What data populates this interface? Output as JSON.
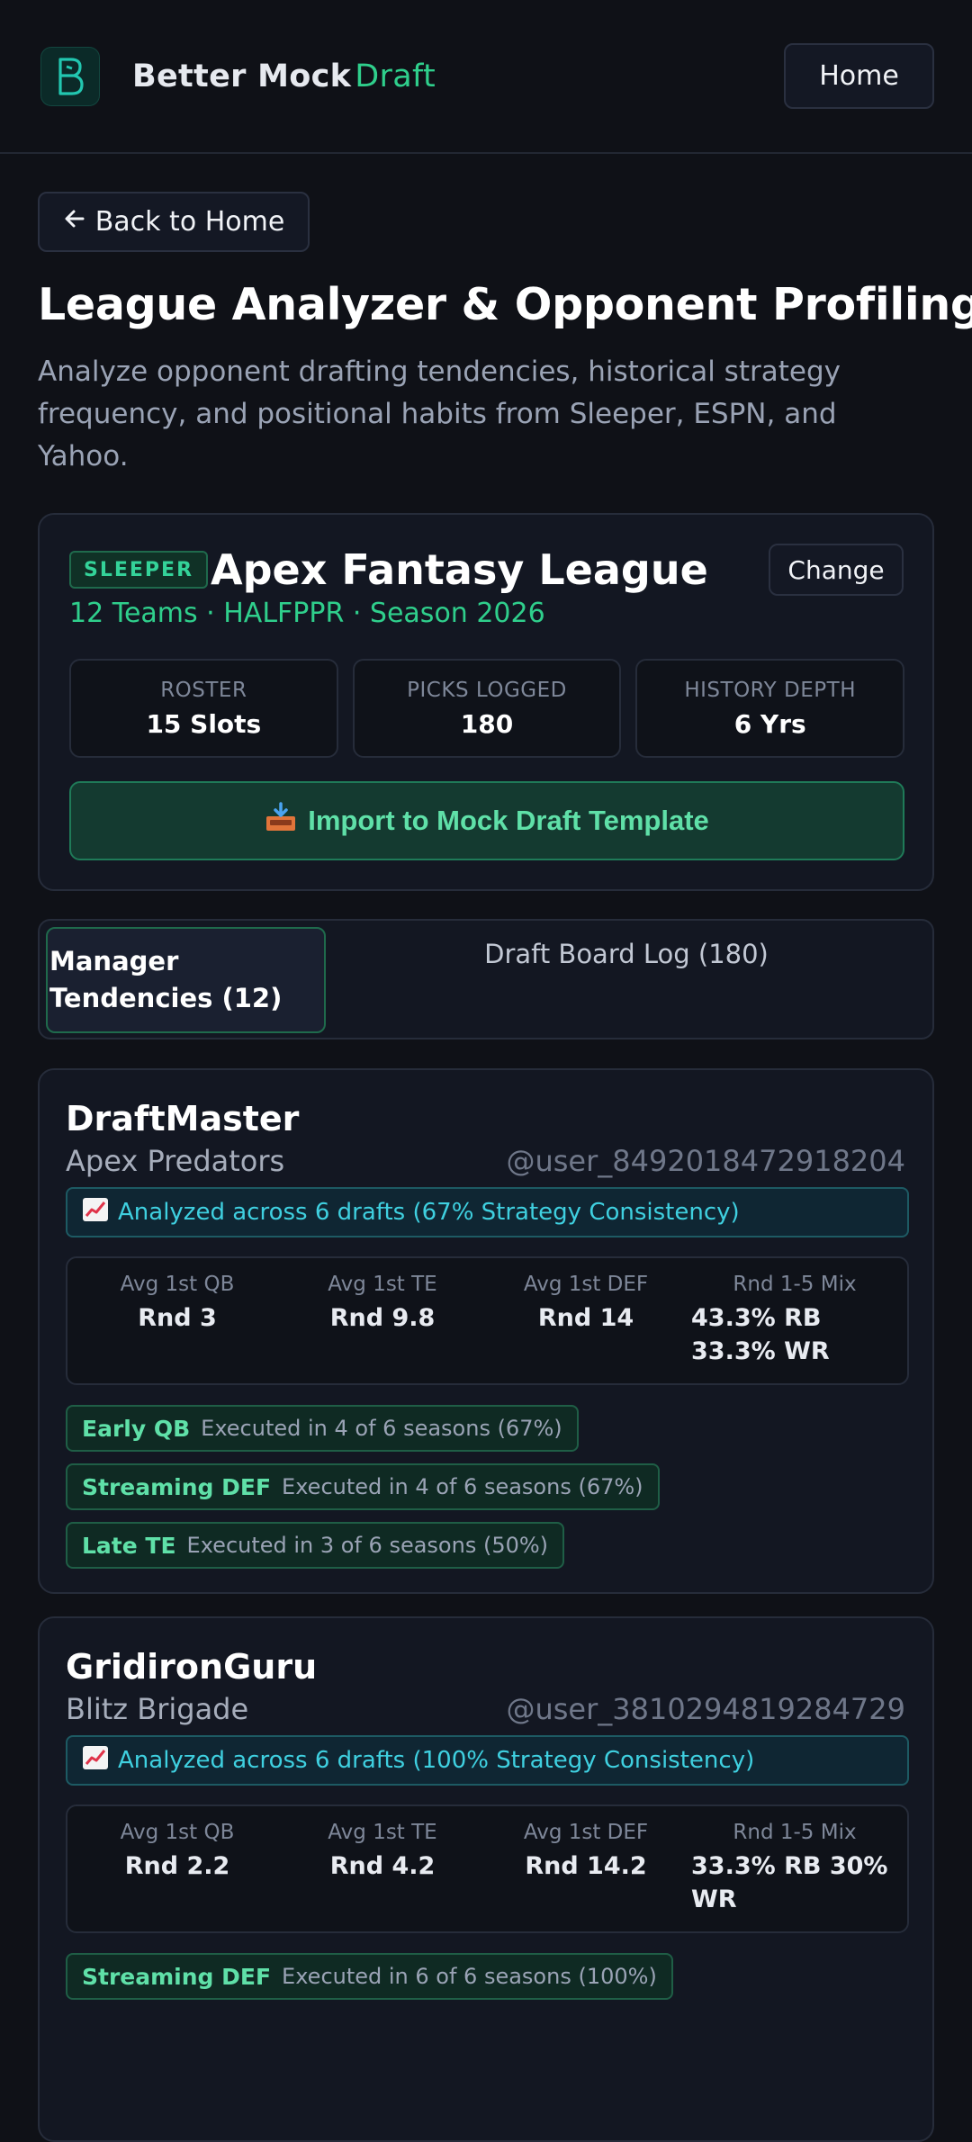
{
  "header": {
    "brand_main": "Better Mock",
    "brand_accent": "Draft",
    "home_label": "Home"
  },
  "back_label": "Back to Home",
  "page": {
    "title": "League Analyzer & Opponent Profiling",
    "description": "Analyze opponent drafting tendencies, historical strategy frequency, and positional habits from Sleeper, ESPN, and Yahoo."
  },
  "league": {
    "platform": "SLEEPER",
    "name": "Apex Fantasy League",
    "meta": "12 Teams · HALFPPR · Season 2026",
    "change_label": "Change",
    "stats": [
      {
        "label": "ROSTER",
        "value": "15 Slots"
      },
      {
        "label": "PICKS LOGGED",
        "value": "180"
      },
      {
        "label": "HISTORY DEPTH",
        "value": "6 Yrs"
      }
    ],
    "import_label": "Import to Mock Draft Template"
  },
  "tabs": {
    "active": "Manager Tendencies (12)",
    "inactive": "Draft Board Log (180)"
  },
  "managers": [
    {
      "name": "DraftMaster",
      "team": "Apex Predators",
      "handle": "@user_8492018472918204",
      "analyzed": "Analyzed across 6 drafts (67% Strategy Consistency)",
      "metrics": [
        {
          "label": "Avg 1st QB",
          "value": "Rnd 3"
        },
        {
          "label": "Avg 1st TE",
          "value": "Rnd 9.8"
        },
        {
          "label": "Avg 1st DEF",
          "value": "Rnd 14"
        },
        {
          "label": "Rnd 1-5 Mix",
          "value": "43.3% RB 33.3% WR"
        }
      ],
      "tags": [
        {
          "name": "Early QB",
          "desc": "Executed in 4 of 6 seasons (67%)"
        },
        {
          "name": "Streaming DEF",
          "desc": "Executed in 4 of 6 seasons (67%)"
        },
        {
          "name": "Late TE",
          "desc": "Executed in 3 of 6 seasons (50%)"
        }
      ]
    },
    {
      "name": "GridironGuru",
      "team": "Blitz Brigade",
      "handle": "@user_3810294819284729",
      "analyzed": "Analyzed across 6 drafts (100% Strategy Consistency)",
      "metrics": [
        {
          "label": "Avg 1st QB",
          "value": "Rnd 2.2"
        },
        {
          "label": "Avg 1st TE",
          "value": "Rnd 4.2"
        },
        {
          "label": "Avg 1st DEF",
          "value": "Rnd 14.2"
        },
        {
          "label": "Rnd 1-5 Mix",
          "value": "33.3% RB 30% WR"
        }
      ],
      "tags": [
        {
          "name": "Streaming DEF",
          "desc": "Executed in 6 of 6 seasons (100%)"
        }
      ]
    }
  ],
  "icons": {
    "logo": "b-logo-icon",
    "back": "arrow-left-icon",
    "import": "inbox-tray-icon",
    "analyzed": "chart-increasing-icon"
  },
  "colors": {
    "background": "#0f1117",
    "card": "#131722",
    "accent_green": "#2fcf8c",
    "accent_cyan": "#3fd0e0"
  }
}
